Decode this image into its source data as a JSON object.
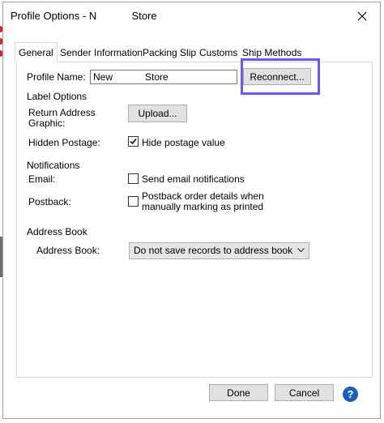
{
  "window": {
    "title": "Profile Options - N            Store"
  },
  "tabs": [
    {
      "label": "General"
    },
    {
      "label": "Sender Information"
    },
    {
      "label": "Packing Slip"
    },
    {
      "label": "Customs"
    },
    {
      "label": "Ship Methods"
    }
  ],
  "profile": {
    "name_label": "Profile Name:",
    "name_value": "New            Store",
    "reconnect_label": "Reconnect..."
  },
  "label_options": {
    "section": "Label Options",
    "return_address_label_line1": "Return Address",
    "return_address_label_line2": "Graphic:",
    "upload_label": "Upload...",
    "hidden_postage_label": "Hidden Postage:",
    "hide_postage_text": "Hide postage value",
    "hide_postage_checked": true
  },
  "notifications": {
    "section": "Notifications",
    "email_label": "Email:",
    "email_text": "Send email notifications",
    "email_checked": false,
    "postback_label": "Postback:",
    "postback_text_line1": "Postback order details when",
    "postback_text_line2": "manually marking as printed",
    "postback_checked": false
  },
  "address_book": {
    "section": "Address Book",
    "label": "Address Book:",
    "selected": "Do not save records to address book"
  },
  "footer": {
    "done_label": "Done",
    "cancel_label": "Cancel",
    "help_label": "?"
  },
  "colors": {
    "highlight": "#6a5ce8",
    "help": "#1c5fb8"
  },
  "icons": [
    "close-icon",
    "checkmark-icon",
    "chevron-down-icon",
    "help-icon"
  ]
}
